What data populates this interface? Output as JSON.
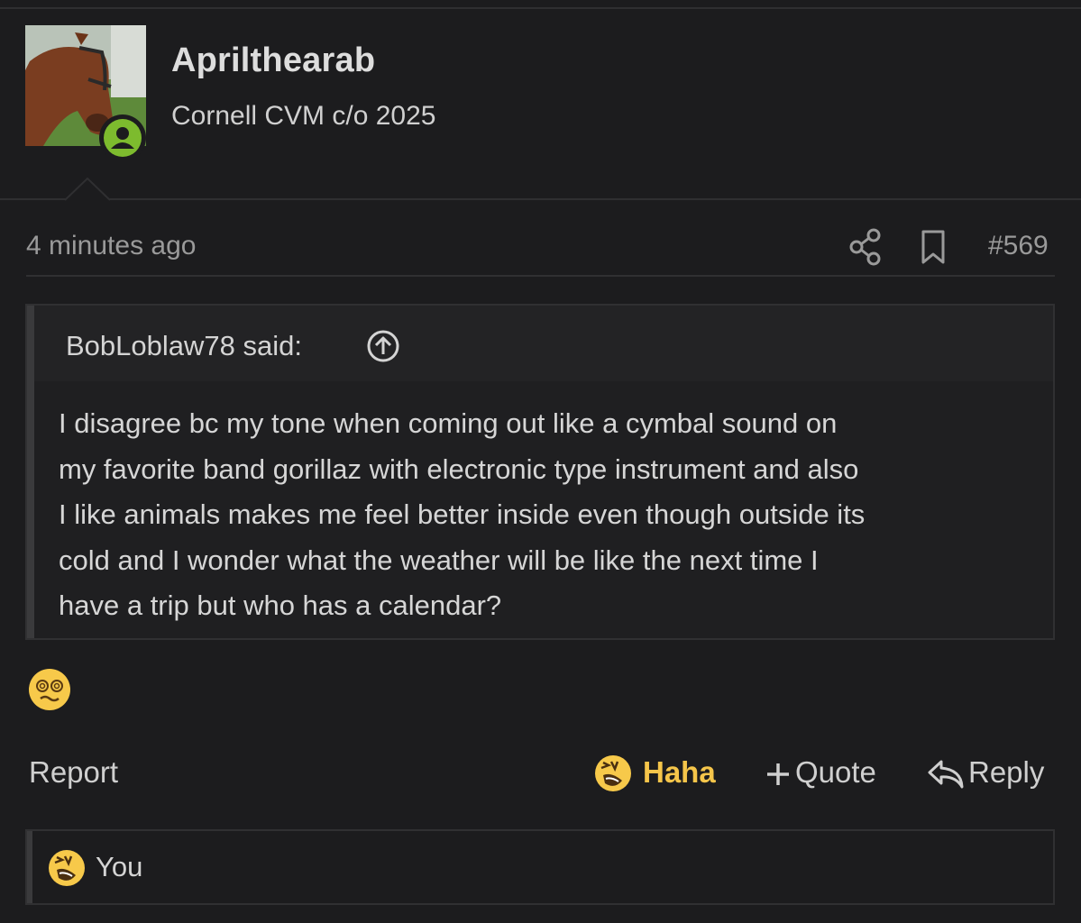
{
  "post": {
    "author": {
      "username": "Aprilthearab",
      "title": "Cornell CVM c/o 2025",
      "avatar_icon": "horse-avatar",
      "status_icon": "online-user-icon",
      "status_color": "#7dbb2e"
    },
    "meta": {
      "timestamp": "4 minutes ago",
      "share_icon": "share-icon",
      "bookmark_icon": "bookmark-icon",
      "post_number": "#569"
    },
    "quote": {
      "author_label": "BobLoblaw78 said:",
      "jump_icon": "arrow-up-circle-icon",
      "lines": [
        "I disagree bc my tone when coming out like a cymbal sound on",
        "my favorite band gorillaz with electronic type instrument and also",
        "I like animals makes me feel better inside even though outside its",
        "cold and I wonder what the weather will be like the next time I",
        "have a trip but who has a calendar?"
      ]
    },
    "body_emoji": "dizzy-face-emoji",
    "actions": {
      "report_label": "Report",
      "haha_label": "Haha",
      "haha_color": "#f5c54a",
      "quote_label": "Quote",
      "reply_label": "Reply"
    },
    "reactions": {
      "emoji": "rofl-emoji",
      "users_label": "You"
    }
  }
}
